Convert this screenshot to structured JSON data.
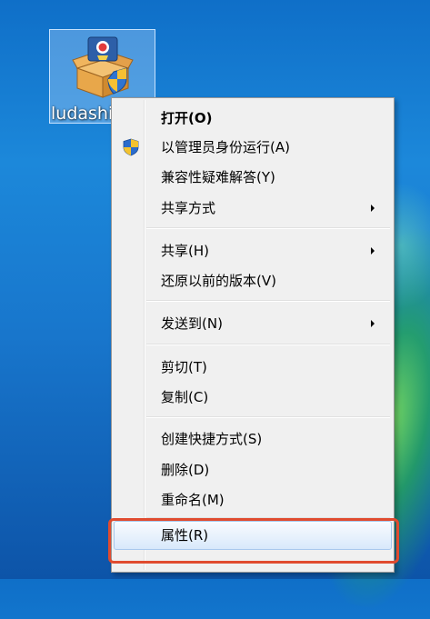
{
  "desktop": {
    "icon_label": "ludashis"
  },
  "context_menu": {
    "items": [
      {
        "label": "打开(O)",
        "bold": true,
        "submenu": false
      },
      {
        "label": "以管理员身份运行(A)",
        "bold": false,
        "submenu": false,
        "icon": "uac-shield-icon"
      },
      {
        "label": "兼容性疑难解答(Y)",
        "bold": false,
        "submenu": false
      },
      {
        "label": "共享方式",
        "bold": false,
        "submenu": true
      },
      {
        "label": "共享(H)",
        "bold": false,
        "submenu": true
      },
      {
        "label": "还原以前的版本(V)",
        "bold": false,
        "submenu": false
      },
      {
        "label": "发送到(N)",
        "bold": false,
        "submenu": true
      },
      {
        "label": "剪切(T)",
        "bold": false,
        "submenu": false
      },
      {
        "label": "复制(C)",
        "bold": false,
        "submenu": false
      },
      {
        "label": "创建快捷方式(S)",
        "bold": false,
        "submenu": false
      },
      {
        "label": "删除(D)",
        "bold": false,
        "submenu": false
      },
      {
        "label": "重命名(M)",
        "bold": false,
        "submenu": false
      },
      {
        "label": "属性(R)",
        "bold": false,
        "submenu": false,
        "highlighted": true
      }
    ]
  },
  "colors": {
    "callout": "#e04b2f",
    "highlight": "#d8e8fb",
    "menu_background": "#f0f0f0"
  },
  "icons": {
    "program": "ludashi-setup-box-icon",
    "elevation": "uac-shield-icon",
    "submenu": "submenu-arrow-icon"
  }
}
